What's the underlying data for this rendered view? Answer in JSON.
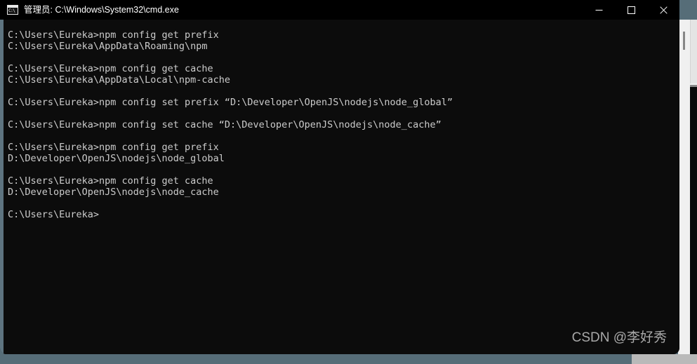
{
  "window": {
    "title": "管理员: C:\\Windows\\System32\\cmd.exe",
    "icon_name": "cmd-icon",
    "icon_text": "C:\\",
    "background_color": "#0c0c0c",
    "titlebar_color": "#000000",
    "text_color": "#cccccc"
  },
  "controls": {
    "minimize_label": "Minimize",
    "maximize_label": "Maximize",
    "close_label": "Close"
  },
  "terminal": {
    "lines": [
      "C:\\Users\\Eureka>npm config get prefix",
      "C:\\Users\\Eureka\\AppData\\Roaming\\npm",
      "",
      "C:\\Users\\Eureka>npm config get cache",
      "C:\\Users\\Eureka\\AppData\\Local\\npm-cache",
      "",
      "C:\\Users\\Eureka>npm config set prefix “D:\\Developer\\OpenJS\\nodejs\\node_global”",
      "",
      "C:\\Users\\Eureka>npm config set cache “D:\\Developer\\OpenJS\\nodejs\\node_cache”",
      "",
      "C:\\Users\\Eureka>npm config get prefix",
      "D:\\Developer\\OpenJS\\nodejs\\node_global",
      "",
      "C:\\Users\\Eureka>npm config get cache",
      "D:\\Developer\\OpenJS\\nodejs\\node_cache",
      "",
      "C:\\Users\\Eureka>"
    ]
  },
  "watermark": {
    "text": "CSDN @李好秀",
    "color": "#b6b6b6"
  },
  "page": {
    "backdrop_color": "#566d78"
  }
}
